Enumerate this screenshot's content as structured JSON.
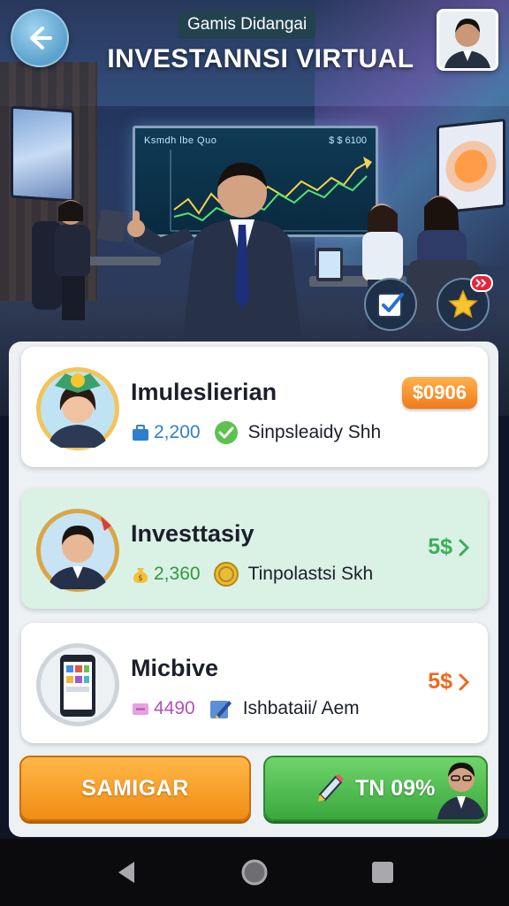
{
  "header": {
    "game_label": "Gamis Didangai",
    "title": "INVESTANNSI VIRTUAL",
    "back_icon": "arrow-left-icon",
    "profile_icon": "user-avatar-icon"
  },
  "scene": {
    "board_title": "Ksmdh lbe Quo",
    "board_value": "$ $ 6100"
  },
  "hero_actions": [
    {
      "icon": "checkbox-icon"
    },
    {
      "icon": "star-icon",
      "badge_icon": "double-chevron-icon"
    }
  ],
  "cards": [
    {
      "name": "Imuleslierian",
      "stat": "2,200",
      "stat_icon": "briefcase-icon",
      "stat_color": "#2f7fd0",
      "tag": "Sinpsleaidy Shh",
      "tag_icon": "check-circle-icon",
      "price": "$0906",
      "price_style": "badge"
    },
    {
      "name": "Investtasiy",
      "stat": "2,360",
      "stat_icon": "money-bag-icon",
      "stat_color": "#2f9a3c",
      "tag": "Tinpolastsi Skh",
      "tag_icon": "coin-icon",
      "price": "5$",
      "price_color": "#3cae5a",
      "price_style": "link"
    },
    {
      "name": "Micbive",
      "stat": "4490",
      "stat_icon": "tag-icon",
      "stat_color": "#b54fb8",
      "tag": "Ishbataii/ Aem",
      "tag_icon": "pen-icon",
      "price": "5$",
      "price_color": "#ee6a1f",
      "price_style": "link"
    }
  ],
  "buttons": {
    "primary": "SAMIGAR",
    "secondary": "TN 09%"
  },
  "nav": {
    "back": "triangle-back-icon",
    "home": "circle-home-icon",
    "recents": "square-recents-icon"
  },
  "colors": {
    "accent_orange": "#f08c14",
    "accent_green": "#3aa83e",
    "card_highlight": "#daf1e6"
  }
}
